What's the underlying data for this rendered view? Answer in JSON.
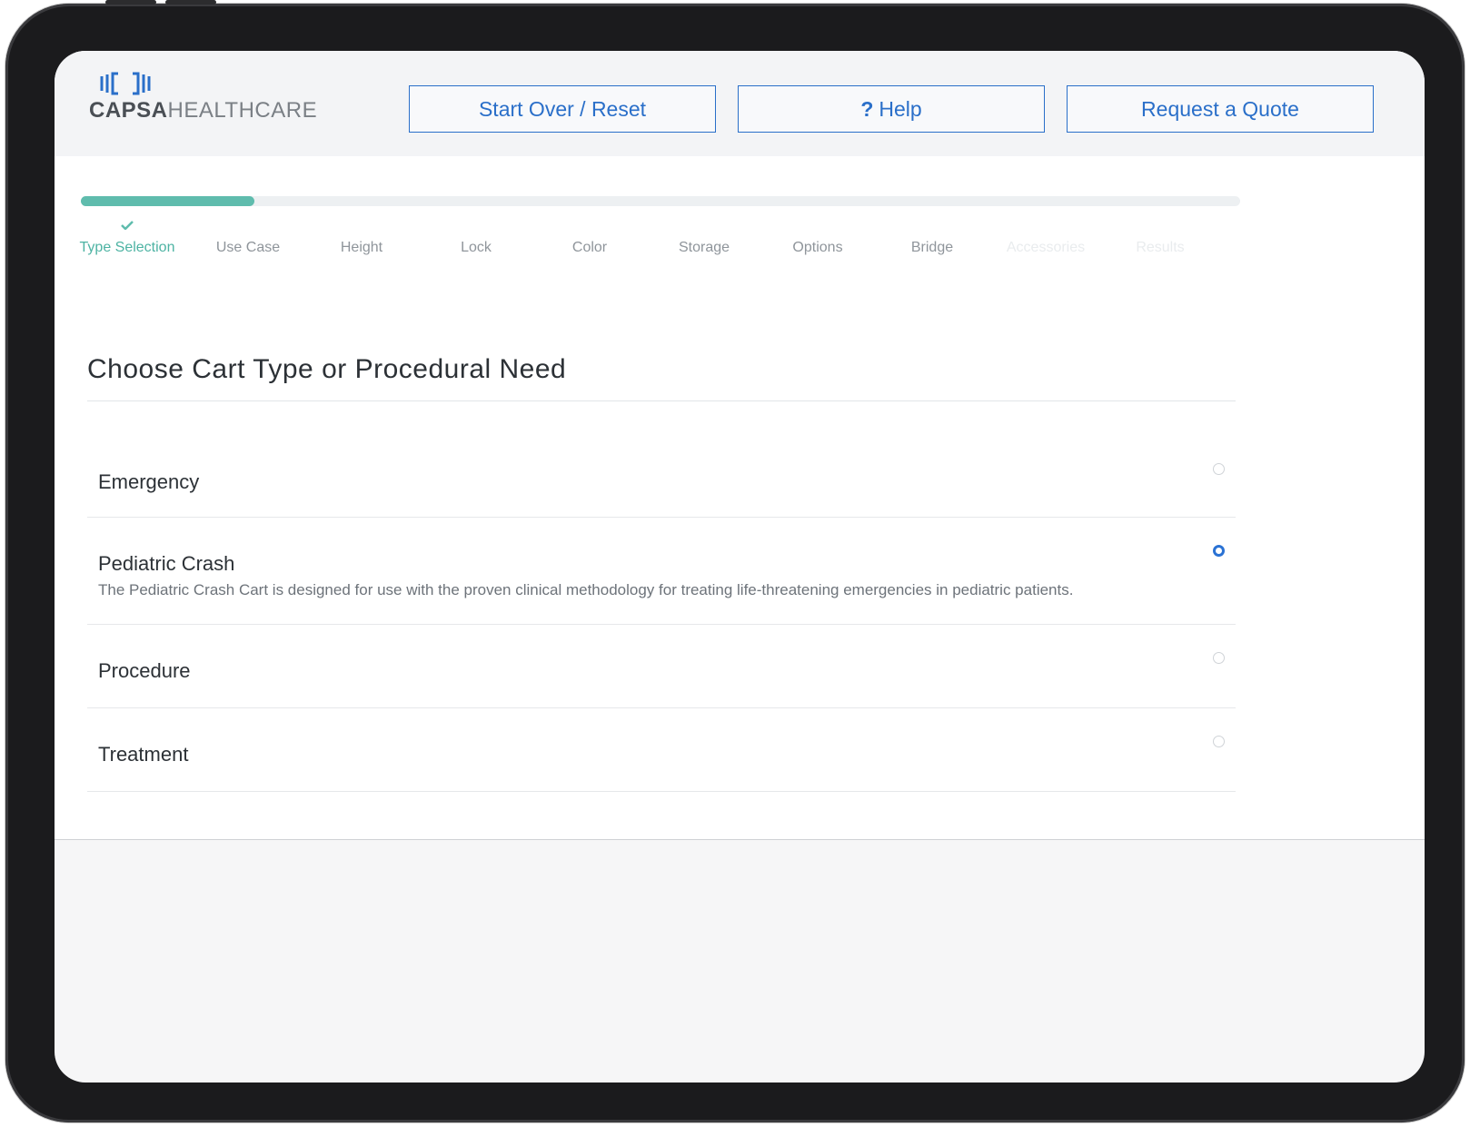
{
  "brand": {
    "logo_primary": "CAPSA",
    "logo_secondary": "HEALTHCARE",
    "accent_color": "#2a6fc9",
    "progress_color": "#5fbcad"
  },
  "header": {
    "start_over_label": "Start Over / Reset",
    "help_icon": "?",
    "help_label": "Help",
    "quote_label": "Request a Quote"
  },
  "progress": {
    "completed_fraction": 0.15,
    "steps": [
      {
        "label": "Type Selection",
        "state": "active"
      },
      {
        "label": "Use Case",
        "state": "pending"
      },
      {
        "label": "Height",
        "state": "pending"
      },
      {
        "label": "Lock",
        "state": "pending"
      },
      {
        "label": "Color",
        "state": "pending"
      },
      {
        "label": "Storage",
        "state": "pending"
      },
      {
        "label": "Options",
        "state": "pending"
      },
      {
        "label": "Bridge",
        "state": "pending"
      },
      {
        "label": "Accessories",
        "state": "faded"
      },
      {
        "label": "Results",
        "state": "faded"
      }
    ]
  },
  "main": {
    "title": "Choose Cart Type or Procedural Need",
    "options": [
      {
        "label": "Emergency",
        "description": "",
        "selected": false
      },
      {
        "label": "Pediatric Crash",
        "description": "The Pediatric Crash Cart is designed for use with the proven clinical methodology for treating life-threatening emergencies in pediatric patients.",
        "selected": true
      },
      {
        "label": "Procedure",
        "description": "",
        "selected": false
      },
      {
        "label": "Treatment",
        "description": "",
        "selected": false
      }
    ]
  }
}
